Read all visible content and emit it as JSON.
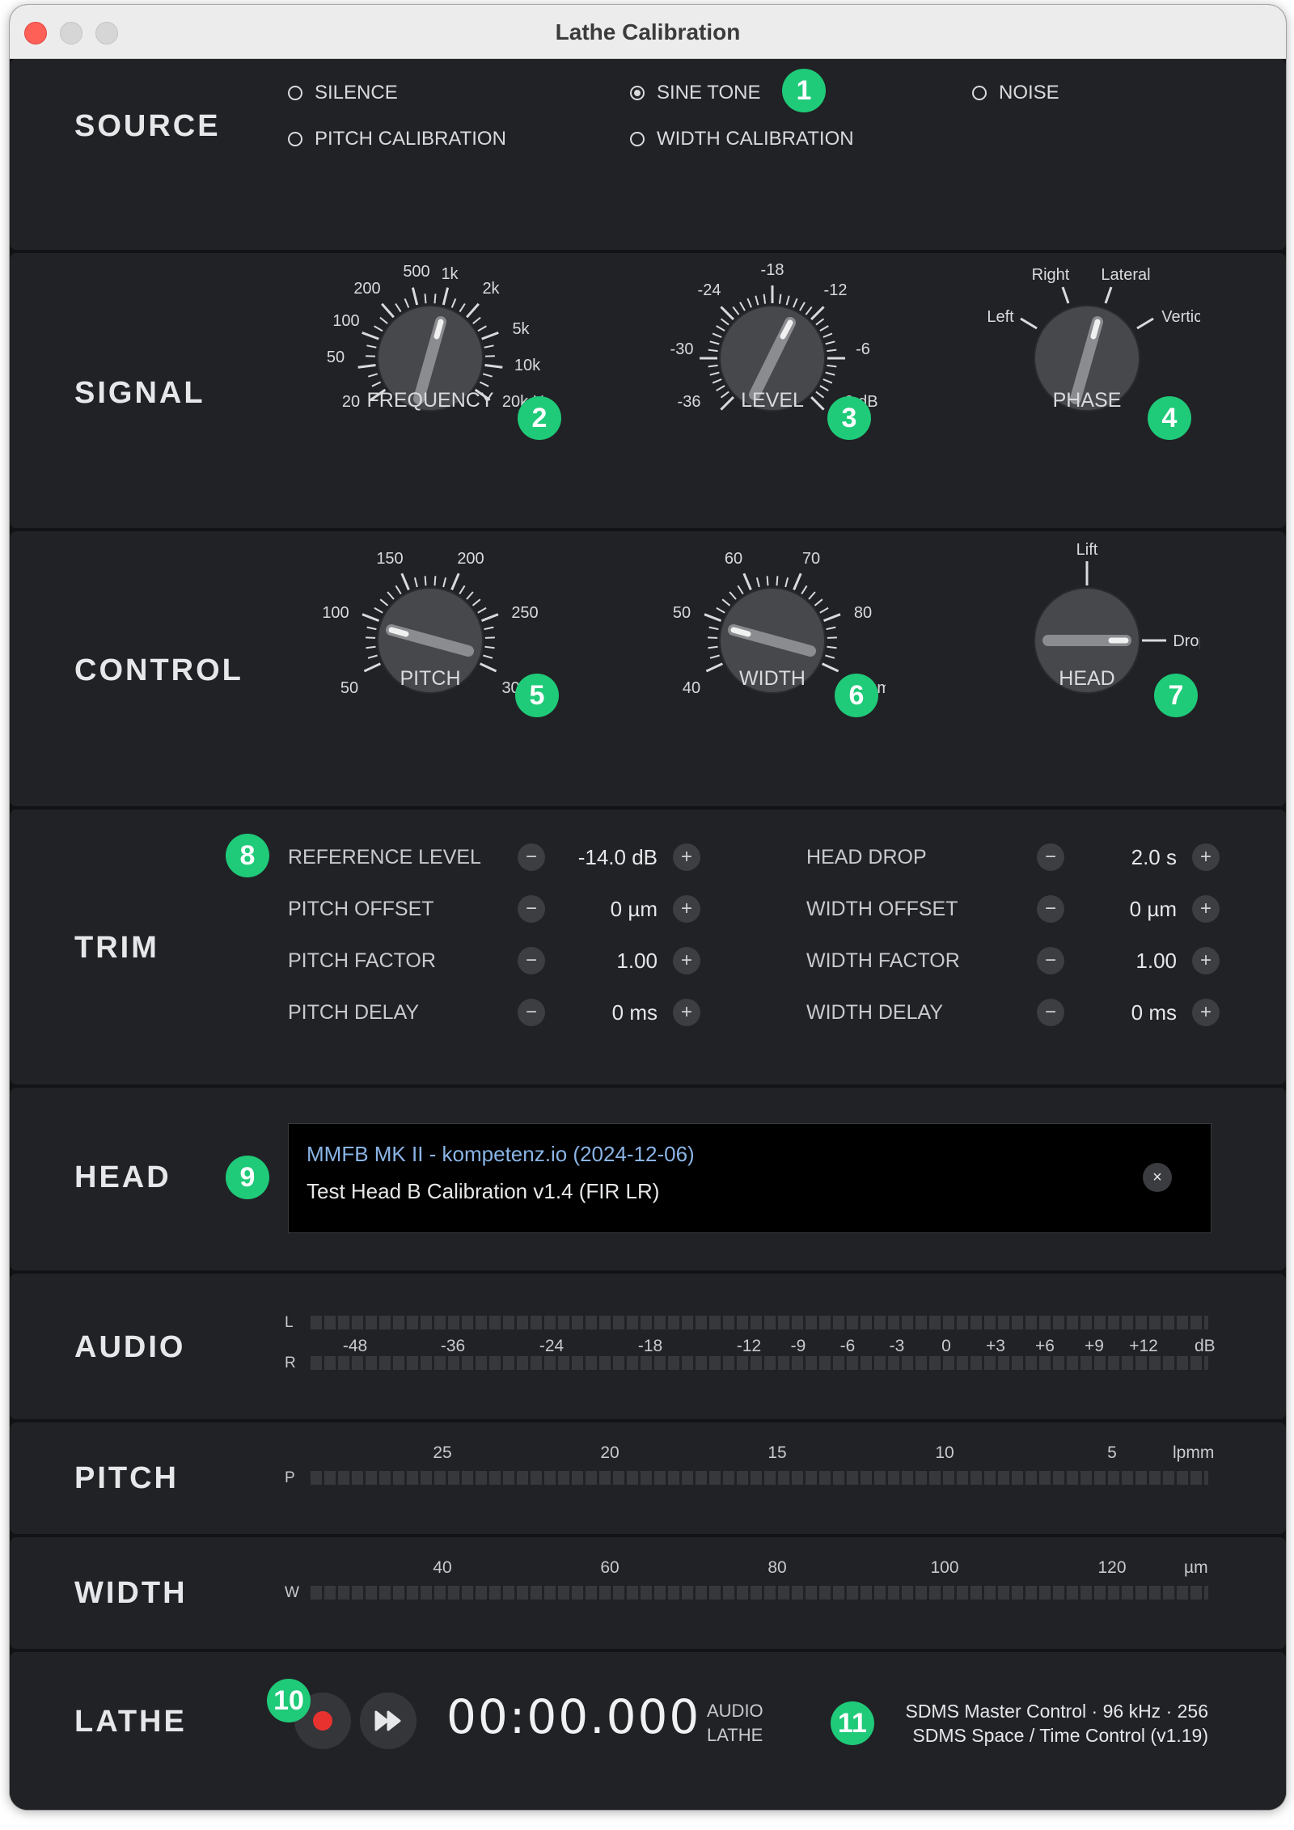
{
  "window": {
    "title": "Lathe Calibration"
  },
  "colors": {
    "accent": "#1fca79",
    "record": "#e8322f",
    "link": "#8ab4e6",
    "panel": "#202225"
  },
  "source": {
    "title": "SOURCE",
    "options": [
      {
        "label": "SILENCE",
        "selected": false
      },
      {
        "label": "SINE TONE",
        "selected": true
      },
      {
        "label": "NOISE",
        "selected": false
      },
      {
        "label": "PITCH CALIBRATION",
        "selected": false
      },
      {
        "label": "WIDTH CALIBRATION",
        "selected": false
      }
    ]
  },
  "signal": {
    "title": "SIGNAL",
    "frequency": {
      "label": "FREQUENCY",
      "ticks": [
        "20",
        "50",
        "100",
        "200",
        "500",
        "1k",
        "2k",
        "5k",
        "10k",
        "20k Hz"
      ]
    },
    "level": {
      "label": "LEVEL",
      "ticks": [
        "-36",
        "-30",
        "-24",
        "-18",
        "-12",
        "-6",
        "0 dB"
      ]
    },
    "phase": {
      "label": "PHASE",
      "ticks": [
        "Left",
        "Right",
        "Lateral",
        "Vertical"
      ]
    }
  },
  "control": {
    "title": "CONTROL",
    "pitch": {
      "label": "PITCH",
      "ticks": [
        "50",
        "100",
        "150",
        "200",
        "250",
        "300 µm"
      ]
    },
    "width": {
      "label": "WIDTH",
      "ticks": [
        "40",
        "50",
        "60",
        "70",
        "80",
        "90 µm"
      ]
    },
    "head": {
      "label": "HEAD",
      "ticks": [
        "Lift",
        "Drop"
      ]
    }
  },
  "trim": {
    "title": "TRIM",
    "rows": [
      {
        "label": "REFERENCE LEVEL",
        "value": "-14.0 dB"
      },
      {
        "label": "HEAD DROP",
        "value": "2.0 s"
      },
      {
        "label": "PITCH OFFSET",
        "value": "0 µm"
      },
      {
        "label": "WIDTH OFFSET",
        "value": "0 µm"
      },
      {
        "label": "PITCH FACTOR",
        "value": "1.00"
      },
      {
        "label": "WIDTH FACTOR",
        "value": "1.00"
      },
      {
        "label": "PITCH DELAY",
        "value": "0 ms"
      },
      {
        "label": "WIDTH DELAY",
        "value": "0 ms"
      }
    ],
    "minus": "−",
    "plus": "+"
  },
  "head": {
    "title": "HEAD",
    "line1": "MMFB MK II - kompetenz.io (2024-12-06)",
    "line2": "Test Head B Calibration v1.4 (FIR LR)",
    "clear_icon": "×"
  },
  "audio": {
    "title": "AUDIO",
    "ch_left": "L",
    "ch_right": "R",
    "scale": [
      "-48",
      "-36",
      "-24",
      "-18",
      "-12",
      "-9",
      "-6",
      "-3",
      "0",
      "+3",
      "+6",
      "+9",
      "+12"
    ],
    "unit": "dB"
  },
  "pitch_meter": {
    "title": "PITCH",
    "ch": "P",
    "scale": [
      "25",
      "20",
      "15",
      "10",
      "5"
    ],
    "unit": "lpmm"
  },
  "width_meter": {
    "title": "WIDTH",
    "ch": "W",
    "scale": [
      "40",
      "60",
      "80",
      "100",
      "120"
    ],
    "unit": "µm"
  },
  "lathe": {
    "title": "LATHE",
    "timecode": "00:00.000",
    "mode_audio": "AUDIO",
    "mode_lathe": "LATHE",
    "info_line1": "SDMS Master Control · 96 kHz · 256",
    "info_line2": "SDMS Space / Time Control (v1.19)"
  },
  "badges": [
    "1",
    "2",
    "3",
    "4",
    "5",
    "6",
    "7",
    "8",
    "9",
    "10",
    "11"
  ]
}
